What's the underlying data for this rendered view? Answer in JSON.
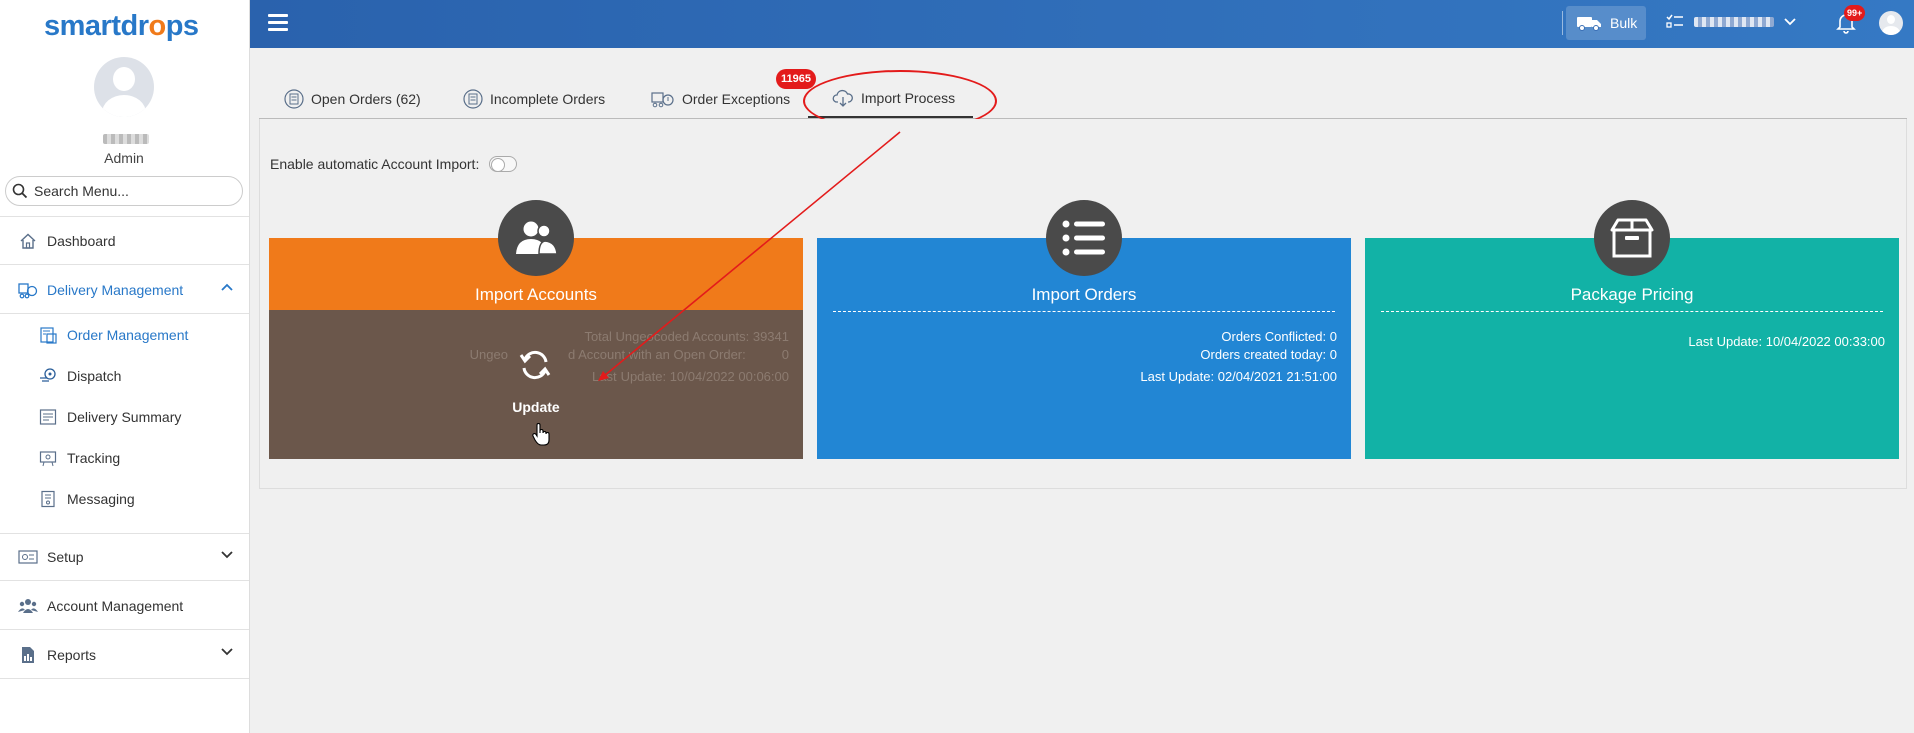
{
  "app": {
    "logo_part1": "smartdr",
    "logo_o": "o",
    "logo_part2": "ps",
    "user_role": "Admin"
  },
  "sidebar": {
    "search_placeholder": "Search Menu...",
    "items": [
      {
        "label": "Dashboard",
        "icon": "house-icon"
      },
      {
        "label": "Delivery Management",
        "icon": "delivery-icon"
      },
      {
        "label": "Setup",
        "icon": "setup-icon"
      },
      {
        "label": "Account Management",
        "icon": "users-icon"
      },
      {
        "label": "Reports",
        "icon": "report-icon"
      }
    ],
    "subitems": [
      {
        "label": "Order Management",
        "icon": "order-icon"
      },
      {
        "label": "Dispatch",
        "icon": "dispatch-icon"
      },
      {
        "label": "Delivery Summary",
        "icon": "summary-icon"
      },
      {
        "label": "Tracking",
        "icon": "tracking-icon"
      },
      {
        "label": "Messaging",
        "icon": "messaging-icon"
      }
    ]
  },
  "topbar": {
    "bulk_label": "Bulk",
    "notification_badge": "99+"
  },
  "tabs": [
    {
      "label": "Open Orders (62)"
    },
    {
      "label": "Incomplete Orders"
    },
    {
      "label": "Order Exceptions"
    },
    {
      "label": "Import Process",
      "active": true
    }
  ],
  "order_exceptions_badge": "11965",
  "settings": {
    "auto_import_label": "Enable automatic Account Import:",
    "auto_import_enabled": false
  },
  "cards": {
    "import_accounts": {
      "title": "Import Accounts",
      "line1": "Total Ungeocoded Accounts: 39341",
      "line2_left": "Ungeo",
      "line2_right": "d Account with an Open Order:",
      "line2_value": "0",
      "line3_left": "Last",
      "line3_right": "Update: 10/04/2022 00:06:00",
      "update_label": "Update",
      "color": "#f07a1a"
    },
    "import_orders": {
      "title": "Import Orders",
      "line1": "Orders Conflicted:  0",
      "line2": "Orders created today:  0",
      "line3": "Last Update:  02/04/2021 21:51:00",
      "color": "#2286d4"
    },
    "package_pricing": {
      "title": "Package Pricing",
      "line1": "Last Update:  10/04/2022 00:33:00",
      "color": "#12b2a6"
    }
  }
}
